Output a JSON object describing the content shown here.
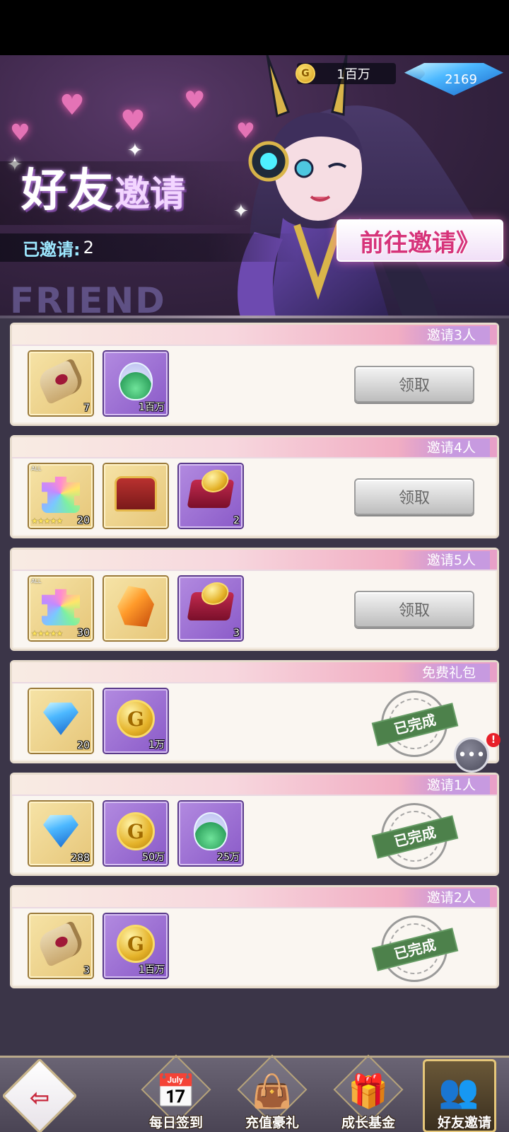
{
  "currency": {
    "gold_label": "1百万",
    "gold_icon_text": "G",
    "gem_label": "2169"
  },
  "banner": {
    "title_part1": "好友",
    "title_part2": "邀请",
    "invited_label": "已邀请:",
    "invited_count": "2",
    "bg_text": "FRIEND",
    "goto_button": "前往邀请》"
  },
  "cards": [
    {
      "header": "邀请3人",
      "items": [
        {
          "icon": "scroll-icon",
          "count": "7"
        },
        {
          "icon": "potion-icon",
          "count": "1百万"
        }
      ],
      "action": "领取",
      "status": "claim"
    },
    {
      "header": "邀请4人",
      "items": [
        {
          "icon": "puzzle-piece-icon",
          "count": "20",
          "stars": "★★★★★",
          "tag": "ALL"
        },
        {
          "icon": "treasure-chest-icon",
          "count": ""
        },
        {
          "icon": "coin-pile-icon",
          "count": "2"
        }
      ],
      "action": "领取",
      "status": "claim"
    },
    {
      "header": "邀请5人",
      "items": [
        {
          "icon": "puzzle-piece-icon",
          "count": "30",
          "stars": "★★★★★",
          "tag": "ALL"
        },
        {
          "icon": "crystal-icon",
          "count": ""
        },
        {
          "icon": "coin-pile-icon",
          "count": "3"
        }
      ],
      "action": "领取",
      "status": "claim"
    },
    {
      "header": "免费礼包",
      "items": [
        {
          "icon": "gem-icon",
          "count": "20"
        },
        {
          "icon": "gold-coin-icon",
          "count": "1万"
        }
      ],
      "action": "已完成",
      "status": "done"
    },
    {
      "header": "邀请1人",
      "items": [
        {
          "icon": "gem-icon",
          "count": "288"
        },
        {
          "icon": "gold-coin-icon",
          "count": "50万"
        },
        {
          "icon": "potion-icon",
          "count": "25万"
        }
      ],
      "action": "已完成",
      "status": "done"
    },
    {
      "header": "邀请2人",
      "items": [
        {
          "icon": "scroll-icon",
          "count": "3"
        },
        {
          "icon": "gold-coin-icon",
          "count": "1百万"
        }
      ],
      "action": "已完成",
      "status": "done"
    }
  ],
  "chat": {
    "badge": "!"
  },
  "nav": {
    "back_icon": "exit-icon",
    "items": [
      {
        "label": "每日签到",
        "icon": "calendar-icon"
      },
      {
        "label": "充值豪礼",
        "icon": "gift-bag-icon"
      },
      {
        "label": "成长基金",
        "icon": "gift-box-icon"
      },
      {
        "label": "好友邀请",
        "icon": "friends-icon",
        "active": true
      }
    ]
  }
}
